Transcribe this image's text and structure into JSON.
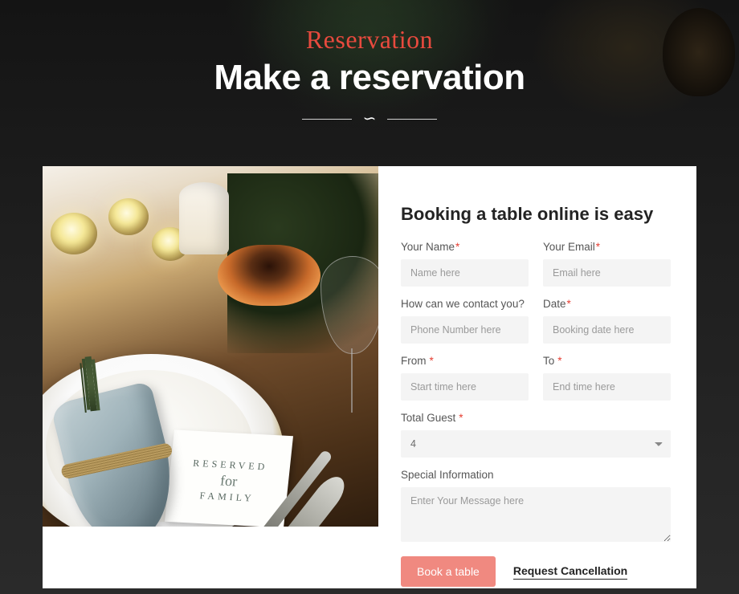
{
  "header": {
    "script_label": "Reservation",
    "title": "Make a reservation"
  },
  "image_card": {
    "reserved_line1": "RESERVED",
    "reserved_for": "for",
    "reserved_line2": "FAMILY"
  },
  "form": {
    "title": "Booking a table online is easy",
    "name": {
      "label": "Your Name",
      "placeholder": "Name here",
      "required": true
    },
    "email": {
      "label": "Your Email",
      "placeholder": "Email here",
      "required": true
    },
    "contact": {
      "label": "How can we contact you?",
      "placeholder": "Phone Number here",
      "required": false
    },
    "date": {
      "label": "Date",
      "placeholder": "Booking date here",
      "required": true
    },
    "from": {
      "label": "From",
      "placeholder": "Start time here",
      "required": true
    },
    "to": {
      "label": "To",
      "placeholder": "End time here",
      "required": true
    },
    "guests": {
      "label": "Total Guest",
      "value": "4",
      "required": true
    },
    "special": {
      "label": "Special Information",
      "placeholder": "Enter Your Message here",
      "required": false
    },
    "submit_label": "Book a table",
    "cancel_label": "Request Cancellation",
    "asterisk": "*"
  }
}
